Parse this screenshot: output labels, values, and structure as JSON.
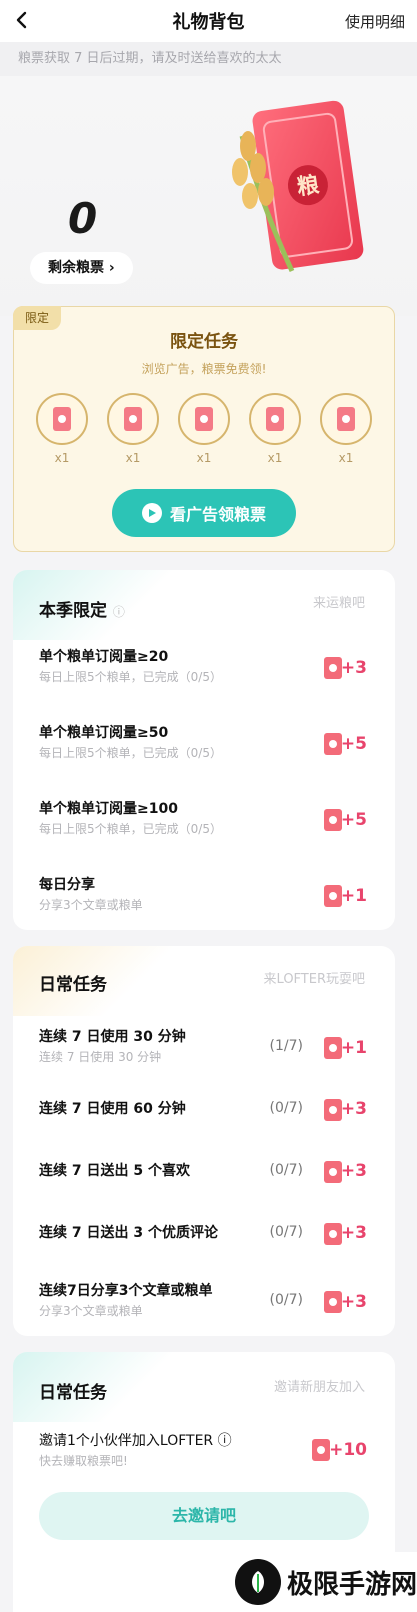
{
  "nav": {
    "title": "礼物背包",
    "detail": "使用明细"
  },
  "notice": "粮票获取 7 日后过期，请及时送给喜欢的太太",
  "hero": {
    "count": "0",
    "remain_label": "剩余粮票 ›",
    "ticket_char": "粮"
  },
  "limited": {
    "tag": "限定",
    "title": "限定任务",
    "subtitle": "浏览广告，粮票免费领!",
    "coins": [
      "x1",
      "x1",
      "x1",
      "x1",
      "x1"
    ],
    "button": "看广告领粮票"
  },
  "season": {
    "title": "本季限定",
    "right": "来运粮吧",
    "tasks": [
      {
        "name": "单个粮单订阅量≥20",
        "desc": "每日上限5个粮单，已完成（0/5）",
        "reward": "+3"
      },
      {
        "name": "单个粮单订阅量≥50",
        "desc": "每日上限5个粮单，已完成（0/5）",
        "reward": "+5"
      },
      {
        "name": "单个粮单订阅量≥100",
        "desc": "每日上限5个粮单，已完成（0/5）",
        "reward": "+5"
      },
      {
        "name": "每日分享",
        "desc": "分享3个文章或粮单",
        "reward": "+1"
      }
    ]
  },
  "daily": {
    "title": "日常任务",
    "right": "来LOFTER玩耍吧",
    "tasks": [
      {
        "name": "连续 7 日使用 30 分钟",
        "desc": "连续 7 日使用 30 分钟",
        "progress": "(1/7)",
        "reward": "+1"
      },
      {
        "name": "连续 7 日使用 60 分钟",
        "desc": "",
        "progress": "(0/7)",
        "reward": "+3"
      },
      {
        "name": "连续 7 日送出 5 个喜欢",
        "desc": "",
        "progress": "(0/7)",
        "reward": "+3"
      },
      {
        "name": "连续 7 日送出 3 个优质评论",
        "desc": "",
        "progress": "(0/7)",
        "reward": "+3"
      },
      {
        "name": "连续7日分享3个文章或粮单",
        "desc": "分享3个文章或粮单",
        "progress": "(0/7)",
        "reward": "+3"
      }
    ]
  },
  "invite": {
    "title": "日常任务",
    "right": "邀请新朋友加入",
    "task": {
      "name": "邀请1个小伙伴加入LOFTER ⓘ",
      "desc": "快去赚取粮票吧!",
      "reward": "+10"
    },
    "button": "去邀请吧"
  },
  "watermark": "极限手游网",
  "colors": {
    "accent": "#2cc4b6",
    "reward": "#e8446c",
    "gold": "#7a5310"
  }
}
